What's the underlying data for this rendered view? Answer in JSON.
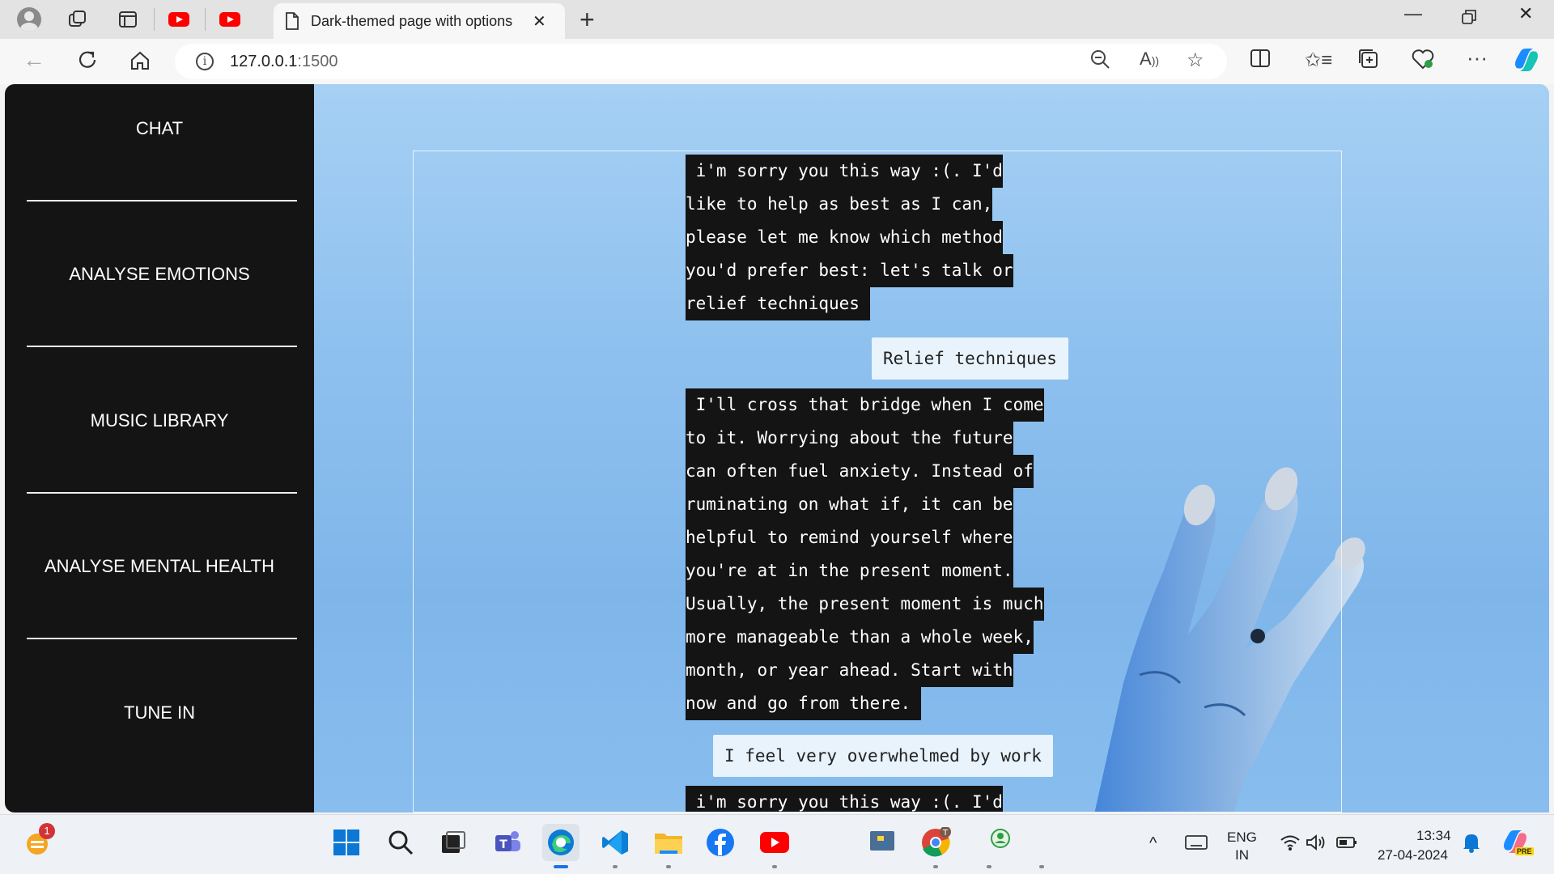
{
  "browser": {
    "tab_title": "Dark-themed page with options",
    "url_host": "127.0.0.1",
    "url_port": ":1500"
  },
  "sidebar": {
    "items": [
      {
        "label": "CHAT"
      },
      {
        "label": "ANALYSE EMOTIONS"
      },
      {
        "label": "MUSIC LIBRARY"
      },
      {
        "label": "ANALYSE MENTAL HEALTH"
      },
      {
        "label": "TUNE IN"
      }
    ]
  },
  "chat": {
    "bot1": [
      " i'm sorry you this way :(. I'd",
      "like to help as best as I can,",
      "please let me know which method",
      "you'd prefer best: let's talk or",
      "relief techniques "
    ],
    "user1": "Relief techniques",
    "bot2": [
      " I'll cross that bridge when I come",
      "to it. Worrying about the future",
      "can often fuel anxiety. Instead of",
      "ruminating on what if, it can be",
      "helpful to remind yourself where",
      "you're at in the present moment.",
      "Usually, the present moment is much",
      "more manageable than a whole week,",
      "month, or year ahead. Start with",
      "now and go from there. "
    ],
    "user2": "I feel very overwhelmed by work",
    "bot3": [
      " i'm sorry you this way :(. I'd"
    ]
  },
  "taskbar": {
    "notification_badge": "1",
    "language_top": "ENG",
    "language_bottom": "IN",
    "time": "13:34",
    "date": "27-04-2024",
    "copilot_badge": "PRE"
  },
  "colors": {
    "sidebar_bg": "#141414",
    "bot_bubble": "#141414",
    "user_bubble": "#e8f3fc",
    "page_bg": "#8fc1ef"
  }
}
